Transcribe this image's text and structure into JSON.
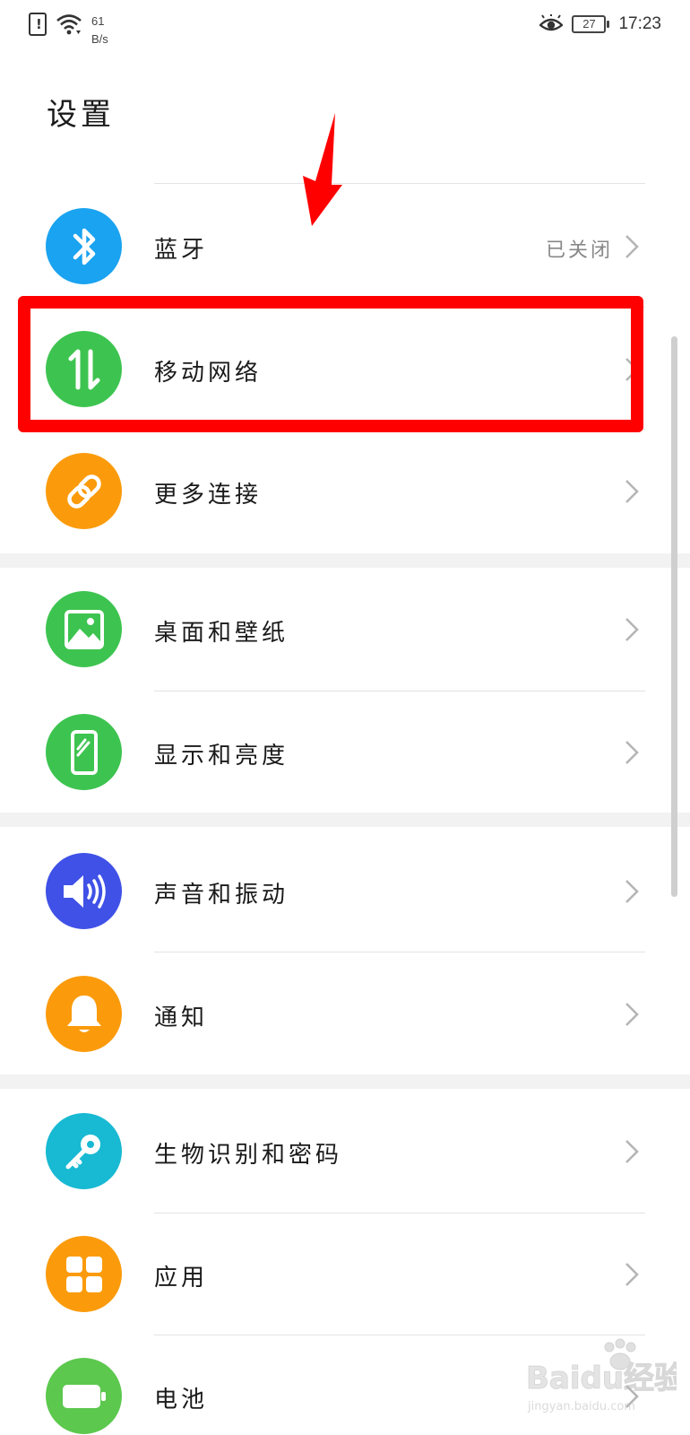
{
  "status_bar": {
    "net_speed_value": "61",
    "net_speed_unit": "B/s",
    "battery_level": "27",
    "time": "17:23"
  },
  "page_title": "设置",
  "items": [
    {
      "label": "蓝牙",
      "value": "已关闭",
      "icon": "bluetooth-icon",
      "color": "#1aa3f0"
    },
    {
      "label": "移动网络",
      "value": "",
      "icon": "mobile-data-icon",
      "color": "#3dc450"
    },
    {
      "label": "更多连接",
      "value": "",
      "icon": "link-icon",
      "color": "#fb9b0b"
    },
    {
      "label": "桌面和壁纸",
      "value": "",
      "icon": "image-icon",
      "color": "#3dc450"
    },
    {
      "label": "显示和亮度",
      "value": "",
      "icon": "phone-display-icon",
      "color": "#3dc450"
    },
    {
      "label": "声音和振动",
      "value": "",
      "icon": "speaker-icon",
      "color": "#3f51e6"
    },
    {
      "label": "通知",
      "value": "",
      "icon": "bell-icon",
      "color": "#fb9b0b"
    },
    {
      "label": "生物识别和密码",
      "value": "",
      "icon": "key-icon",
      "color": "#18b9d2"
    },
    {
      "label": "应用",
      "value": "",
      "icon": "apps-grid-icon",
      "color": "#fb9b0b"
    },
    {
      "label": "电池",
      "value": "",
      "icon": "battery-icon",
      "color": "#5cc84e"
    }
  ],
  "watermark": {
    "brand": "Baidu经验",
    "url": "jingyan.baidu.com"
  },
  "colors": {
    "annotation_red": "#ff0000",
    "chevron": "#b5b5b5"
  }
}
